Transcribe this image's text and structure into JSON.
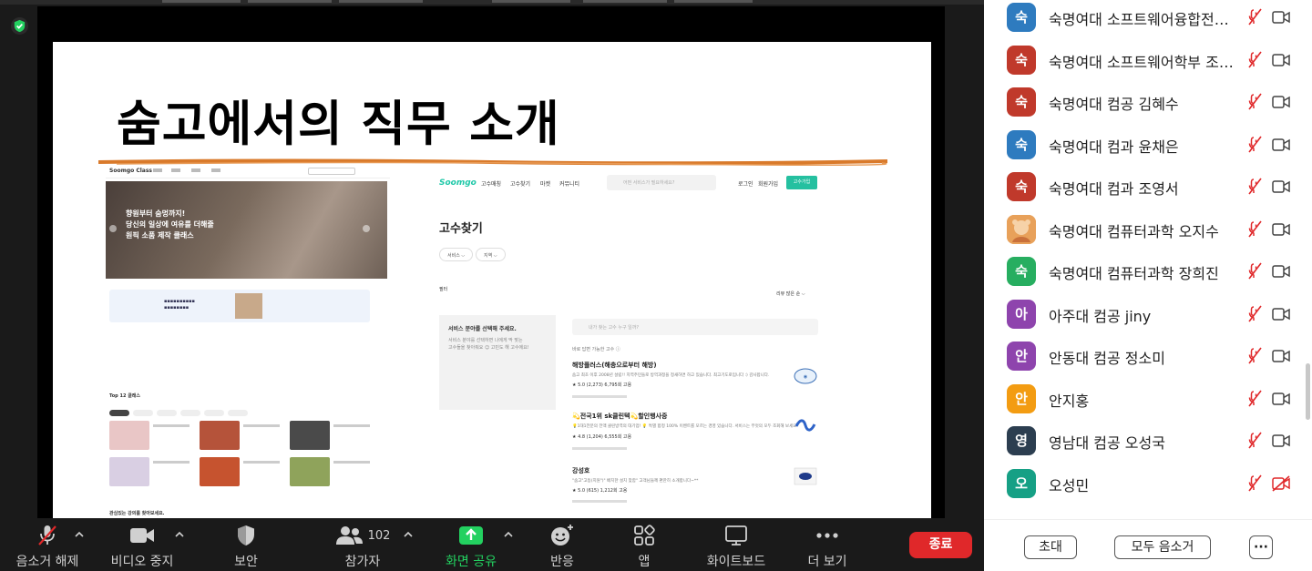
{
  "slide": {
    "title": "숨고에서의 직무 소개",
    "left_mock": {
      "logo": "Soomgo Class",
      "hero_lines": [
        "향원부터 숨멍까지!",
        "당신의 일상에 여유를 더해줄",
        "원픽 소품 제작 클래스"
      ],
      "section_top": "Top 12 클래스",
      "section_bottom": "관심있는 강의를 찾아보세요."
    },
    "right_mock": {
      "logo": "Soomgo",
      "nav": [
        "고수매칭",
        "고수찾기",
        "마켓",
        "커뮤니티"
      ],
      "search_placeholder": "어떤 서비스가 필요하세요?",
      "login": "로그인",
      "signup": "회원가입",
      "pro_join": "고수가입",
      "heading": "고수찾기",
      "filters": [
        "서비스 ⌵",
        "지역 ⌵"
      ],
      "filter_label": "필터",
      "sort_label": "리뷰 많은 순 ⌵",
      "empty_title": "서비스 분야를 선택해 주세요.",
      "empty_desc": [
        "서비스 분야를 선택하면 나에게 딱 맞는",
        "고수들을 찾아줘요 ☺ 고민도 해 고수에요!"
      ],
      "search2_placeholder": "내가 찾는 고수 누구 일까?",
      "available_label": "바로 답변 가능한 고수 ⓘ",
      "items": [
        {
          "title": "해방플러스(해충으로부터 해방)",
          "desc": "숨고 최초 이후 2008년 설립!! 지역주민들로 방역과정을 정새하면 하고 있습니다. 최고기도로입니다 :) 감사합니다.",
          "stats": "★ 5.0 (2,273)  6,795회 고용"
        },
        {
          "title": "💫전국1위 sk클린텍💫할인행사중",
          "desc": "💡1대1전분의 전액 클린방역의 대기업! 💡 특별 합정 100% 이벤트를 모르는 경영 있습니다. 서비스는 무엇의 모두 조회해 보세요",
          "stats": "★ 4.8 (1,204)  6,555회 고용"
        },
        {
          "title": "강성호",
          "desc": "\"숨고\"고등(지원\")\" 배치한 설치 맞함\" 고객님들께 편한히 소개합니다~**",
          "stats": "★ 5.0 (615)  1,212회 고용"
        }
      ]
    }
  },
  "toolbar": {
    "mute": "음소거 해제",
    "video": "비디오 중지",
    "security": "보안",
    "participants": "참가자",
    "participant_count": "102",
    "share": "화면 공유",
    "reactions": "반응",
    "apps": "앱",
    "whiteboard": "화이트보드",
    "more": "더 보기",
    "end": "종료"
  },
  "participants": [
    {
      "initial": "숙",
      "name": "숙명여대 소프트웨어융합전공 ...",
      "color": "#2e7bbf",
      "video_off": false
    },
    {
      "initial": "숙",
      "name": "숙명여대 소프트웨어학부 조현...",
      "color": "#c0392b",
      "video_off": false
    },
    {
      "initial": "숙",
      "name": "숙명여대 컴공 김혜수",
      "color": "#c0392b",
      "video_off": false
    },
    {
      "initial": "숙",
      "name": "숙명여대 컴과 윤채은",
      "color": "#2e7bbf",
      "video_off": false
    },
    {
      "initial": "숙",
      "name": "숙명여대 컴과 조영서",
      "color": "#c0392b",
      "video_off": false
    },
    {
      "initial": "",
      "name": "숙명여대 컴퓨터과학 오지수",
      "color": "#e8a15a",
      "video_off": false,
      "photo": true
    },
    {
      "initial": "숙",
      "name": "숙명여대 컴퓨터과학 장희진",
      "color": "#27ae60",
      "video_off": false
    },
    {
      "initial": "아",
      "name": "아주대 컴공 jiny",
      "color": "#8e44ad",
      "video_off": false
    },
    {
      "initial": "안",
      "name": "안동대 컴공 정소미",
      "color": "#8e44ad",
      "video_off": false
    },
    {
      "initial": "안",
      "name": "안지홍",
      "color": "#f39c12",
      "video_off": false
    },
    {
      "initial": "영",
      "name": "영남대 컴공 오성국",
      "color": "#2c3e50",
      "video_off": false
    },
    {
      "initial": "오",
      "name": "오성민",
      "color": "#16a085",
      "video_off": true
    }
  ],
  "panel_footer": {
    "invite": "초대",
    "mute_all": "모두 음소거",
    "more": "···"
  },
  "colors": {
    "end_red": "#e0282a",
    "share_green": "#23d160",
    "mic_off_red": "#e0282a"
  }
}
